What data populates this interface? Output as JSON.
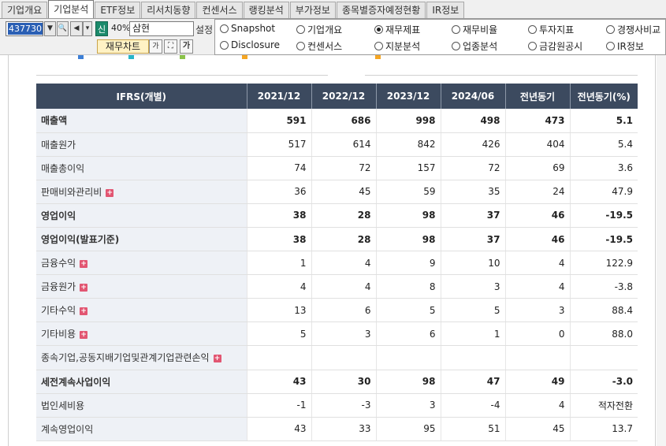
{
  "tabs": [
    "기업개요",
    "기업분석",
    "ETF정보",
    "리서치동향",
    "컨센서스",
    "랭킹분석",
    "부가정보",
    "종목별증자예정현황",
    "IR정보"
  ],
  "active_tab": 1,
  "toolbar": {
    "code": "437730",
    "shin": "신",
    "percent": "40%",
    "name": "삼현",
    "setting": "설정",
    "fin_chart": "재무차트",
    "ga": "가",
    "ga2": "가"
  },
  "radios": [
    {
      "label": "Snapshot",
      "checked": false
    },
    {
      "label": "기업개요",
      "checked": false
    },
    {
      "label": "재무제표",
      "checked": true
    },
    {
      "label": "재무비율",
      "checked": false
    },
    {
      "label": "투자지표",
      "checked": false
    },
    {
      "label": "경쟁사비교",
      "checked": false
    },
    {
      "label": "Disclosure",
      "checked": false
    },
    {
      "label": "컨센서스",
      "checked": false
    },
    {
      "label": "지분분석",
      "checked": false
    },
    {
      "label": "업종분석",
      "checked": false
    },
    {
      "label": "금감원공시",
      "checked": false
    },
    {
      "label": "IR정보",
      "checked": false
    }
  ],
  "legend": {
    "colors": [
      "#3d7fd6",
      "#27b6c9",
      "#8bc34a",
      "#f5a623",
      "#f5a623"
    ]
  },
  "table": {
    "headers": [
      "IFRS(개별)",
      "2021/12",
      "2022/12",
      "2023/12",
      "2024/06",
      "전년동기",
      "전년동기(%)"
    ],
    "rows": [
      {
        "label": "매출액",
        "bold": true,
        "plus": false,
        "values": [
          "591",
          "686",
          "998",
          "498",
          "473",
          "5.1"
        ]
      },
      {
        "label": "매출원가",
        "bold": false,
        "plus": false,
        "values": [
          "517",
          "614",
          "842",
          "426",
          "404",
          "5.4"
        ]
      },
      {
        "label": "매출총이익",
        "bold": false,
        "plus": false,
        "values": [
          "74",
          "72",
          "157",
          "72",
          "69",
          "3.6"
        ]
      },
      {
        "label": "판매비와관리비",
        "bold": false,
        "plus": true,
        "values": [
          "36",
          "45",
          "59",
          "35",
          "24",
          "47.9"
        ]
      },
      {
        "label": "영업이익",
        "bold": true,
        "plus": false,
        "values": [
          "38",
          "28",
          "98",
          "37",
          "46",
          "-19.5"
        ]
      },
      {
        "label": "영업이익(발표기준)",
        "bold": true,
        "plus": false,
        "values": [
          "38",
          "28",
          "98",
          "37",
          "46",
          "-19.5"
        ]
      },
      {
        "label": "금융수익",
        "bold": false,
        "plus": true,
        "values": [
          "1",
          "4",
          "9",
          "10",
          "4",
          "122.9"
        ]
      },
      {
        "label": "금융원가",
        "bold": false,
        "plus": true,
        "values": [
          "4",
          "4",
          "8",
          "3",
          "4",
          "-3.8"
        ]
      },
      {
        "label": "기타수익",
        "bold": false,
        "plus": true,
        "values": [
          "13",
          "6",
          "5",
          "5",
          "3",
          "88.4"
        ]
      },
      {
        "label": "기타비용",
        "bold": false,
        "plus": true,
        "values": [
          "5",
          "3",
          "6",
          "1",
          "0",
          "88.0"
        ]
      },
      {
        "label": "종속기업,공동지배기업및관계기업관련손익",
        "bold": false,
        "plus": true,
        "values": [
          "",
          "",
          "",
          "",
          "",
          ""
        ]
      },
      {
        "label": "세전계속사업이익",
        "bold": true,
        "plus": false,
        "values": [
          "43",
          "30",
          "98",
          "47",
          "49",
          "-3.0"
        ]
      },
      {
        "label": "법인세비용",
        "bold": false,
        "plus": false,
        "values": [
          "-1",
          "-3",
          "3",
          "-4",
          "4",
          "적자전환"
        ]
      },
      {
        "label": "계속영업이익",
        "bold": false,
        "plus": false,
        "values": [
          "43",
          "33",
          "95",
          "51",
          "45",
          "13.7"
        ]
      }
    ]
  }
}
